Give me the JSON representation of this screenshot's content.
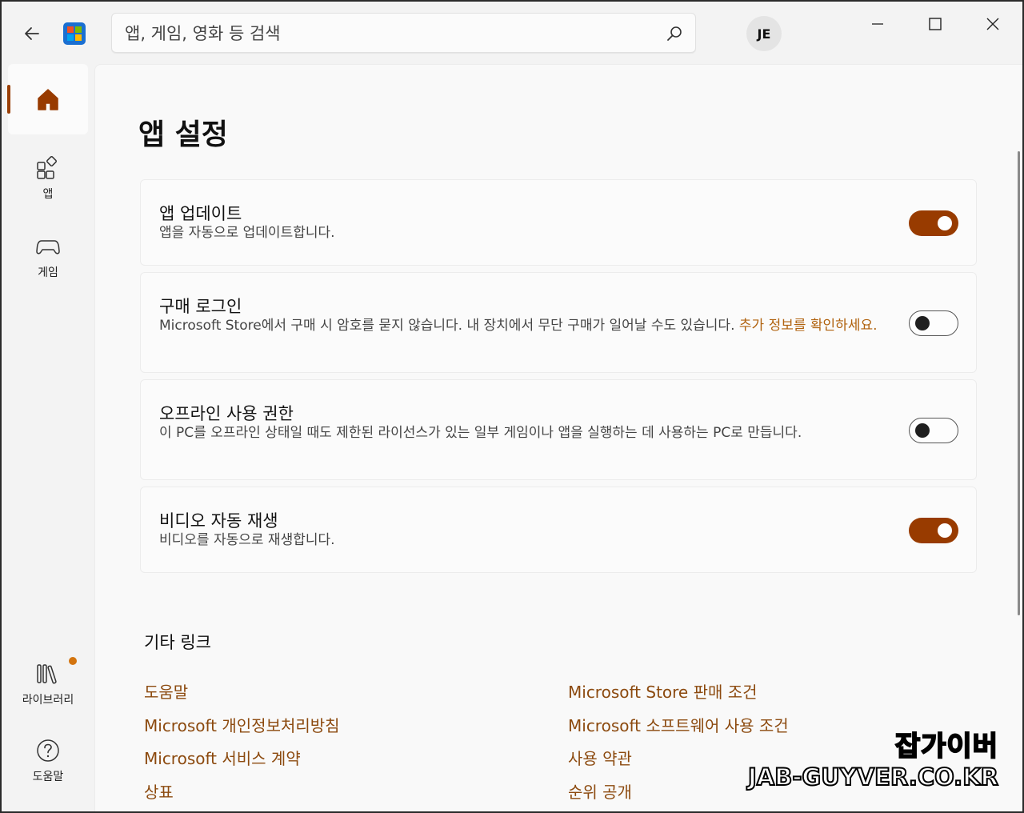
{
  "titlebar": {
    "search_placeholder": "앱, 게임, 영화 등 검색",
    "avatar_initials": "JE",
    "logo_colors": [
      "#f25022",
      "#7fba00",
      "#00a4ef",
      "#ffb900"
    ]
  },
  "sidebar": {
    "items": [
      {
        "label": "",
        "icon": "home-icon",
        "active": true
      },
      {
        "label": "앱",
        "icon": "apps-icon"
      },
      {
        "label": "게임",
        "icon": "gamepad-icon"
      },
      {
        "label": "라이브러리",
        "icon": "library-icon",
        "notification_dot": true
      },
      {
        "label": "도움말",
        "icon": "help-icon"
      }
    ]
  },
  "main": {
    "title": "앱 설정",
    "settings": [
      {
        "title": "앱 업데이트",
        "desc": "앱을 자동으로 업데이트합니다.",
        "link": "",
        "on": true
      },
      {
        "title": "구매 로그인",
        "desc": "Microsoft Store에서 구매 시 암호를 묻지 않습니다. 내 장치에서 무단 구매가 일어날 수도 있습니다. ",
        "link": "추가 정보를 확인하세요.",
        "on": false
      },
      {
        "title": "오프라인 사용 권한",
        "desc": "이 PC를 오프라인 상태일 때도 제한된 라이선스가 있는 일부 게임이나 앱을 실행하는 데 사용하는 PC로 만듭니다.",
        "link": "",
        "on": false
      },
      {
        "title": "비디오 자동 재생",
        "desc": "비디오를 자동으로 재생합니다.",
        "link": "",
        "on": true
      }
    ],
    "other_links_title": "기타 링크",
    "links_left": [
      "도움말",
      "Microsoft 개인정보처리방침",
      "Microsoft 서비스 계약",
      "상표"
    ],
    "links_right": [
      "Microsoft Store 판매 조건",
      "Microsoft 소프트웨어 사용 조건",
      "사용 약관",
      "순위 공개"
    ]
  },
  "watermark": {
    "line1": "잡가이버",
    "line2": "JAB-GUYVER.CO.KR"
  },
  "colors": {
    "accent": "#983b00",
    "link": "#8c4a0f",
    "inline_link": "#b0620e"
  }
}
